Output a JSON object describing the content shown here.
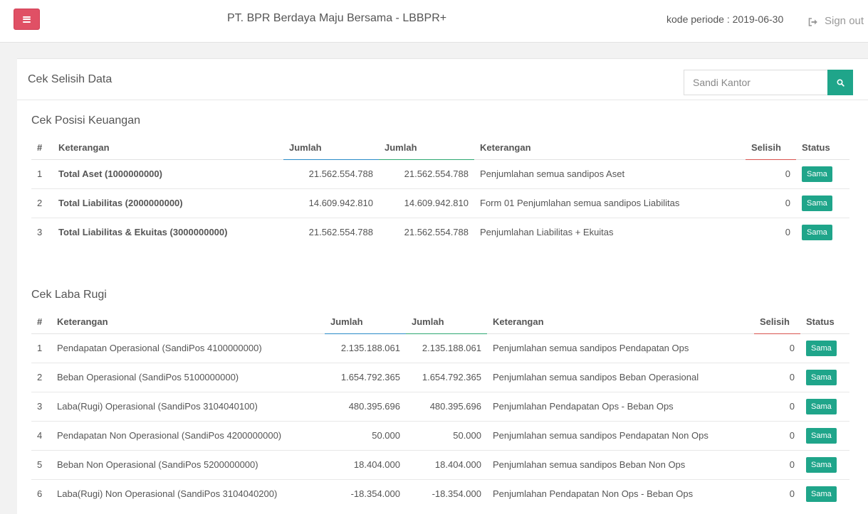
{
  "header": {
    "app_title": "PT. BPR Berdaya Maju Bersama - LBBPR+",
    "periode": "kode periode : 2019-06-30",
    "signout": "Sign out"
  },
  "panel": {
    "title": "Cek Selisih Data",
    "search_placeholder": "Sandi Kantor"
  },
  "posisi_keuangan": {
    "title": "Cek Posisi Keuangan",
    "columns": [
      "#",
      "Keterangan",
      "Jumlah",
      "Jumlah",
      "Keterangan",
      "Selisih",
      "Status"
    ],
    "rows": [
      {
        "no": "1",
        "ket": "Total Aset (1000000000)",
        "j1": "21.562.554.788",
        "j2": "21.562.554.788",
        "ket2": "Penjumlahan semua sandipos Aset",
        "selisih": "0",
        "status": "Sama"
      },
      {
        "no": "2",
        "ket": "Total Liabilitas (2000000000)",
        "j1": "14.609.942.810",
        "j2": "14.609.942.810",
        "ket2": "Form 01 Penjumlahan semua sandipos Liabilitas",
        "selisih": "0",
        "status": "Sama"
      },
      {
        "no": "3",
        "ket": "Total Liabilitas & Ekuitas (3000000000)",
        "j1": "21.562.554.788",
        "j2": "21.562.554.788",
        "ket2": "Penjumlahan Liabilitas + Ekuitas",
        "selisih": "0",
        "status": "Sama"
      }
    ]
  },
  "laba_rugi": {
    "title": "Cek Laba Rugi",
    "columns": [
      "#",
      "Keterangan",
      "Jumlah",
      "Jumlah",
      "Keterangan",
      "Selisih",
      "Status"
    ],
    "rows": [
      {
        "no": "1",
        "ket": "Pendapatan Operasional (SandiPos 4100000000)",
        "j1": "2.135.188.061",
        "j2": "2.135.188.061",
        "ket2": "Penjumlahan semua sandipos Pendapatan Ops",
        "selisih": "0",
        "status": "Sama"
      },
      {
        "no": "2",
        "ket": "Beban Operasional (SandiPos 5100000000)",
        "j1": "1.654.792.365",
        "j2": "1.654.792.365",
        "ket2": "Penjumlahan semua sandipos Beban Operasional",
        "selisih": "0",
        "status": "Sama"
      },
      {
        "no": "3",
        "ket": "Laba(Rugi) Operasional (SandiPos 3104040100)",
        "j1": "480.395.696",
        "j2": "480.395.696",
        "ket2": "Penjumlahan Pendapatan Ops - Beban Ops",
        "selisih": "0",
        "status": "Sama"
      },
      {
        "no": "4",
        "ket": "Pendapatan Non Operasional (SandiPos 4200000000)",
        "j1": "50.000",
        "j2": "50.000",
        "ket2": "Penjumlahan semua sandipos Pendapatan Non Ops",
        "selisih": "0",
        "status": "Sama"
      },
      {
        "no": "5",
        "ket": "Beban Non Operasional (SandiPos 5200000000)",
        "j1": "18.404.000",
        "j2": "18.404.000",
        "ket2": "Penjumlahan semua sandipos Beban Non Ops",
        "selisih": "0",
        "status": "Sama"
      },
      {
        "no": "6",
        "ket": "Laba(Rugi) Non Operasional (SandiPos 3104040200)",
        "j1": "-18.354.000",
        "j2": "-18.354.000",
        "ket2": "Penjumlahan Pendapatan Non Ops - Beban Ops",
        "selisih": "0",
        "status": "Sama"
      }
    ]
  },
  "colors": {
    "menu_button": "#e05065",
    "accent_green": "#1fa58a",
    "jumlah1_underline": "#2a8bc8",
    "jumlah2_underline": "#2ea872",
    "selisih_underline": "#d9534f"
  },
  "icons": {
    "menu": "menu-icon",
    "signout": "sign-out-icon",
    "search": "search-icon"
  }
}
